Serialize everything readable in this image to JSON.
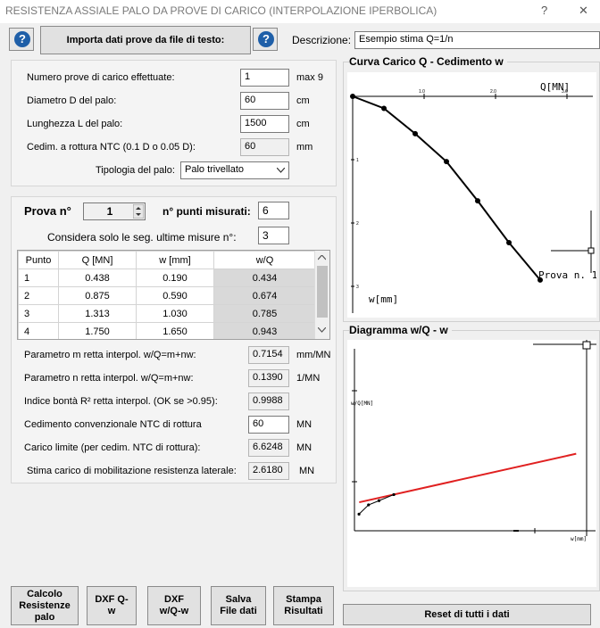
{
  "window": {
    "title": "RESISTENZA ASSIALE PALO DA PROVE DI CARICO (INTERPOLAZIONE IPERBOLICA)",
    "help_glyph": "?",
    "close_glyph": "✕"
  },
  "toolbar": {
    "help_glyph": "?",
    "import_label": "Importa dati prove da file di testo:",
    "description_label": "Descrizione:",
    "description_value": "Esempio stima Q=1/n"
  },
  "pile": {
    "num_tests_label": "Numero prove di carico effettuate:",
    "num_tests_value": "1",
    "num_tests_unit": "max 9",
    "diameter_label": "Diametro D del palo:",
    "diameter_value": "60",
    "diameter_unit": "cm",
    "length_label": "Lunghezza L del palo:",
    "length_value": "1500",
    "length_unit": "cm",
    "ntc_label": "Cedim. a rottura NTC (0.1 D o 0.05 D):",
    "ntc_value": "60",
    "ntc_unit": "mm",
    "type_label": "Tipologia del palo:",
    "type_value": "Palo trivellato"
  },
  "test": {
    "prova_label": "Prova n°",
    "prova_value": "1",
    "points_label": "n° punti misurati:",
    "points_value": "6",
    "last_seg_label": "Considera solo le seg. ultime misure  n°:",
    "last_seg_value": "3",
    "columns": [
      "Punto",
      "Q [MN]",
      "w [mm]",
      "w/Q"
    ],
    "rows": [
      [
        "1",
        "0.438",
        "0.190",
        "0.434"
      ],
      [
        "2",
        "0.875",
        "0.590",
        "0.674"
      ],
      [
        "3",
        "1.313",
        "1.030",
        "0.785"
      ],
      [
        "4",
        "1.750",
        "1.650",
        "0.943"
      ]
    ]
  },
  "results": {
    "m_label": "Parametro m retta interpol.  w/Q=m+nw:",
    "m_value": "0.7154",
    "m_unit": "mm/MN",
    "n_label": "Parametro n retta interpol.  w/Q=m+nw:",
    "n_value": "0.1390",
    "n_unit": "1/MN",
    "r2_label": "Indice bontà R² retta interpol. (OK se >0.95):",
    "r2_value": "0.9988",
    "ntc_label": "Cedimento convenzionale NTC di rottura",
    "ntc_value": "60",
    "ntc_unit": "MN",
    "limit_label": "Carico limite (per cedim. NTC di rottura):",
    "limit_value": "6.6248",
    "limit_unit": "MN",
    "lateral_label": "Stima carico di mobilitazione resistenza laterale:",
    "lateral_value": "2.6180",
    "lateral_unit": "MN"
  },
  "chart1": {
    "title": "Curva Carico Q - Cedimento w",
    "x_axis_label": "Q[MN]",
    "y_axis_label": "w[mm]",
    "series_label": "Prova n. 1",
    "x_ticks": [
      "1.0",
      "2.0",
      "3.0"
    ],
    "y_ticks": [
      "1",
      "2",
      "3"
    ]
  },
  "chart2": {
    "title": "Diagramma  w/Q - w",
    "y_axis_label": "w/Q[MN]",
    "x_axis_label": "w[mm]"
  },
  "chart_data": [
    {
      "type": "line",
      "title": "Curva Carico Q - Cedimento w",
      "xlabel": "Q[MN]",
      "ylabel": "w[mm]",
      "xlim": [
        0,
        3
      ],
      "ylim": [
        0,
        3
      ],
      "series": [
        {
          "name": "Prova n. 1",
          "x": [
            0,
            0.438,
            0.875,
            1.313,
            1.75,
            2.188,
            2.625
          ],
          "y": [
            0,
            0.19,
            0.59,
            1.03,
            1.65,
            2.31,
            2.9
          ]
        }
      ],
      "color": "#000000"
    },
    {
      "type": "scatter",
      "title": "Diagramma  w/Q - w",
      "xlabel": "w[mm]",
      "ylabel": "w/Q[MN]",
      "points_x": [
        0.19,
        0.59,
        1.03,
        1.65
      ],
      "points_y": [
        0.434,
        0.674,
        0.785,
        0.943
      ],
      "fit_line": {
        "m": 0.7154,
        "n": 0.139
      },
      "fit_color": "#e02020"
    }
  ],
  "buttons": {
    "calc": "Calcolo Resistenze palo",
    "dxf_qw": "DXF Q-w",
    "dxf_wqw": "DXF w/Q-w",
    "save": "Salva File dati",
    "print": "Stampa Risultati",
    "reset": "Reset di tutti i dati"
  }
}
